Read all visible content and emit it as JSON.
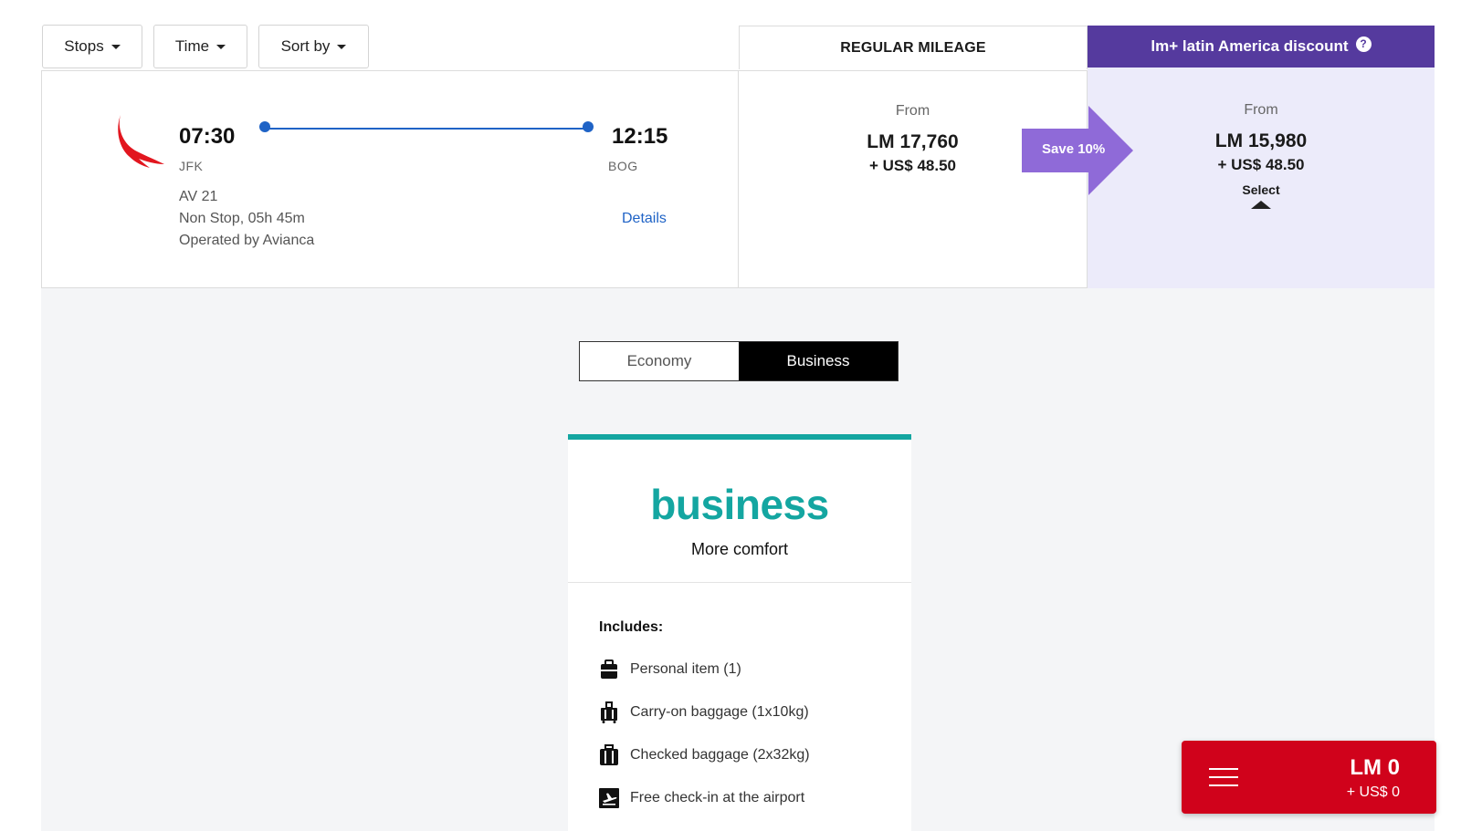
{
  "filters": [
    {
      "label": "Stops"
    },
    {
      "label": "Time"
    },
    {
      "label": "Sort by"
    }
  ],
  "mileage_tabs": {
    "regular": "REGULAR MILEAGE",
    "discount": "lm+ latin America discount",
    "help_glyph": "?"
  },
  "flight": {
    "departure_time": "07:30",
    "departure_code": "JFK",
    "arrival_time": "12:15",
    "arrival_code": "BOG",
    "flight_number": "AV 21",
    "duration": "Non Stop, 05h 45m",
    "operator": "Operated by Avianca",
    "details_link": "Details"
  },
  "prices": {
    "regular": {
      "from": "From",
      "miles": "LM 17,760",
      "fee": "+ US$ 48.50"
    },
    "discount": {
      "from": "From",
      "miles": "LM 15,980",
      "fee": "+ US$ 48.50",
      "select": "Select"
    },
    "save_badge": "Save 10%"
  },
  "cabin_toggle": {
    "options": [
      "Economy",
      "Business"
    ],
    "selected": "Business"
  },
  "fare": {
    "title": "business",
    "subtitle": "More comfort",
    "includes_label": "Includes:",
    "benefits": [
      {
        "label": "Personal item (1)",
        "icon": "personal-item-icon"
      },
      {
        "label": "Carry-on baggage (1x10kg)",
        "icon": "carry-on-icon"
      },
      {
        "label": "Checked baggage (2x32kg)",
        "icon": "checked-baggage-icon"
      },
      {
        "label": "Free check-in at the airport",
        "icon": "check-in-icon"
      }
    ]
  },
  "cart": {
    "miles": "LM 0",
    "fee": "+ US$ 0"
  },
  "colors": {
    "discount_purple": "#553a9e",
    "save_badge": "#8f6ad8",
    "discount_bg": "#ecebfa",
    "route_blue": "#1f63c6",
    "fare_teal": "#14a6a1",
    "cart_red": "#d0021b"
  }
}
